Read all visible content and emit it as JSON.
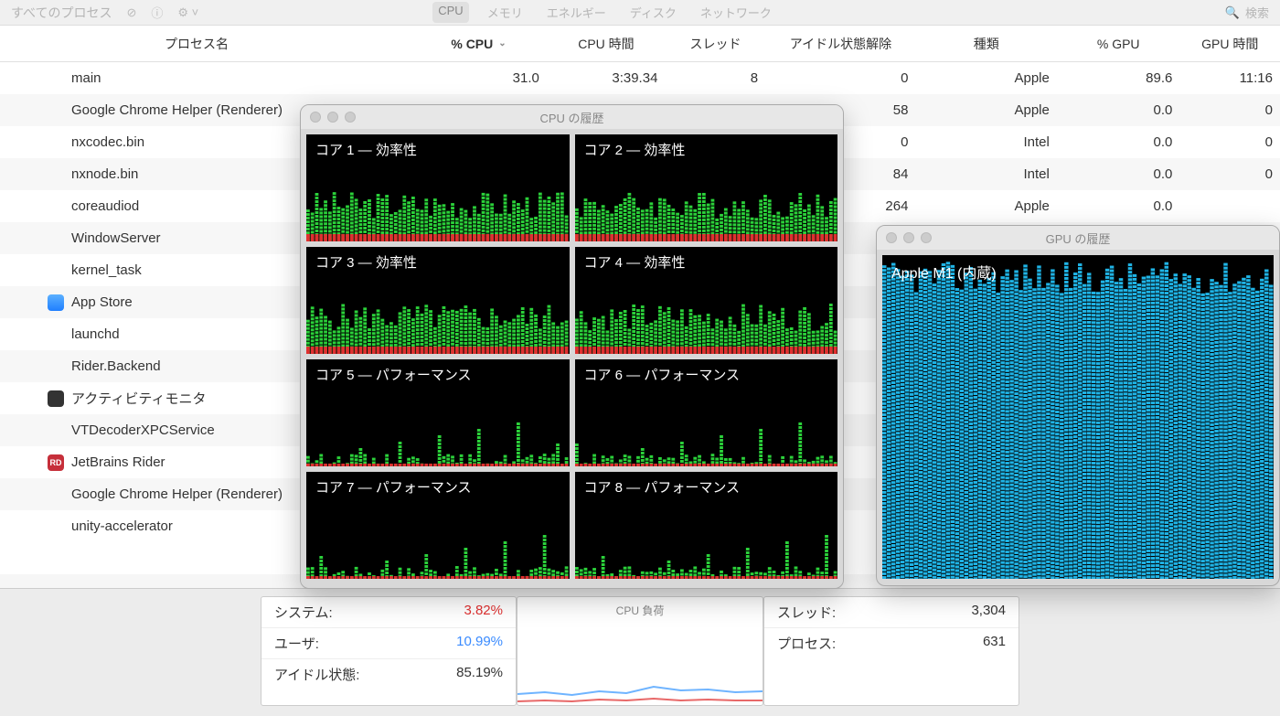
{
  "toolbar": {
    "process_scope": "すべてのプロセス",
    "tabs": [
      "CPU",
      "メモリ",
      "エネルギー",
      "ディスク",
      "ネットワーク"
    ],
    "active_tab": 0,
    "search_placeholder": "検索"
  },
  "columns": {
    "name": "プロセス名",
    "cpu": "% CPU",
    "cpu_time": "CPU 時間",
    "threads": "スレッド",
    "idle_wake": "アイドル状態解除",
    "kind": "種類",
    "gpu": "% GPU",
    "gpu_time": "GPU 時間"
  },
  "rows": [
    {
      "icon": "none",
      "name": "main",
      "cpu": "31.0",
      "cpu_time": "3:39.34",
      "threads": "8",
      "idle": "0",
      "kind": "Apple",
      "gpu": "89.6",
      "gtime": "11:16"
    },
    {
      "icon": "none",
      "name": "Google Chrome Helper (Renderer)",
      "cpu": "",
      "cpu_time": "",
      "threads": "",
      "idle": "58",
      "kind": "Apple",
      "gpu": "0.0",
      "gtime": "0"
    },
    {
      "icon": "none",
      "name": "nxcodec.bin",
      "cpu": "",
      "cpu_time": "",
      "threads": "",
      "idle": "0",
      "kind": "Intel",
      "gpu": "0.0",
      "gtime": "0"
    },
    {
      "icon": "none",
      "name": "nxnode.bin",
      "cpu": "",
      "cpu_time": "",
      "threads": "",
      "idle": "84",
      "kind": "Intel",
      "gpu": "0.0",
      "gtime": "0"
    },
    {
      "icon": "none",
      "name": "coreaudiod",
      "cpu": "",
      "cpu_time": "",
      "threads": "",
      "idle": "264",
      "kind": "Apple",
      "gpu": "0.0",
      "gtime": ""
    },
    {
      "icon": "none",
      "name": "WindowServer",
      "cpu": "",
      "cpu_time": "",
      "threads": "",
      "idle": "",
      "kind": "",
      "gpu": "",
      "gtime": ""
    },
    {
      "icon": "none",
      "name": "kernel_task",
      "cpu": "",
      "cpu_time": "",
      "threads": "",
      "idle": "",
      "kind": "",
      "gpu": "",
      "gtime": ""
    },
    {
      "icon": "blue",
      "name": "App Store",
      "cpu": "",
      "cpu_time": "",
      "threads": "",
      "idle": "",
      "kind": "",
      "gpu": "",
      "gtime": ""
    },
    {
      "icon": "none",
      "name": "launchd",
      "cpu": "",
      "cpu_time": "",
      "threads": "",
      "idle": "",
      "kind": "",
      "gpu": "",
      "gtime": ""
    },
    {
      "icon": "none",
      "name": "Rider.Backend",
      "cpu": "",
      "cpu_time": "",
      "threads": "",
      "idle": "",
      "kind": "",
      "gpu": "",
      "gtime": ""
    },
    {
      "icon": "dark",
      "name": "アクティビティモニタ",
      "cpu": "",
      "cpu_time": "",
      "threads": "",
      "idle": "",
      "kind": "",
      "gpu": "",
      "gtime": ""
    },
    {
      "icon": "none",
      "name": "VTDecoderXPCService",
      "cpu": "",
      "cpu_time": "",
      "threads": "",
      "idle": "",
      "kind": "",
      "gpu": "",
      "gtime": ""
    },
    {
      "icon": "rd",
      "name": "JetBrains Rider",
      "cpu": "",
      "cpu_time": "",
      "threads": "",
      "idle": "",
      "kind": "",
      "gpu": "",
      "gtime": ""
    },
    {
      "icon": "none",
      "name": "Google Chrome Helper (Renderer)",
      "cpu": "",
      "cpu_time": "",
      "threads": "",
      "idle": "",
      "kind": "",
      "gpu": "",
      "gtime": ""
    },
    {
      "icon": "none",
      "name": "unity-accelerator",
      "cpu": "",
      "cpu_time": "",
      "threads": "",
      "idle": "",
      "kind": "",
      "gpu": "",
      "gtime": ""
    }
  ],
  "cpu_history": {
    "title": "CPU の履歴",
    "cores": [
      {
        "label": "コア 1 — 効率性",
        "profile": "eff"
      },
      {
        "label": "コア 2 — 効率性",
        "profile": "eff"
      },
      {
        "label": "コア 3 — 効率性",
        "profile": "eff"
      },
      {
        "label": "コア 4 — 効率性",
        "profile": "eff"
      },
      {
        "label": "コア 5 — パフォーマンス",
        "profile": "perf"
      },
      {
        "label": "コア 6 — パフォーマンス",
        "profile": "perf"
      },
      {
        "label": "コア 7 — パフォーマンス",
        "profile": "perf"
      },
      {
        "label": "コア 8 — パフォーマンス",
        "profile": "perf"
      }
    ]
  },
  "gpu_history": {
    "title": "GPU の履歴",
    "device": "Apple M1 (内蔵)"
  },
  "summary": {
    "system_label": "システム:",
    "system_value": "3.82%",
    "user_label": "ユーザ:",
    "user_value": "10.99%",
    "idle_label": "アイドル状態:",
    "idle_value": "85.19%",
    "load_title": "CPU 負荷",
    "threads_label": "スレッド:",
    "threads_value": "3,304",
    "procs_label": "プロセス:",
    "procs_value": "631"
  }
}
